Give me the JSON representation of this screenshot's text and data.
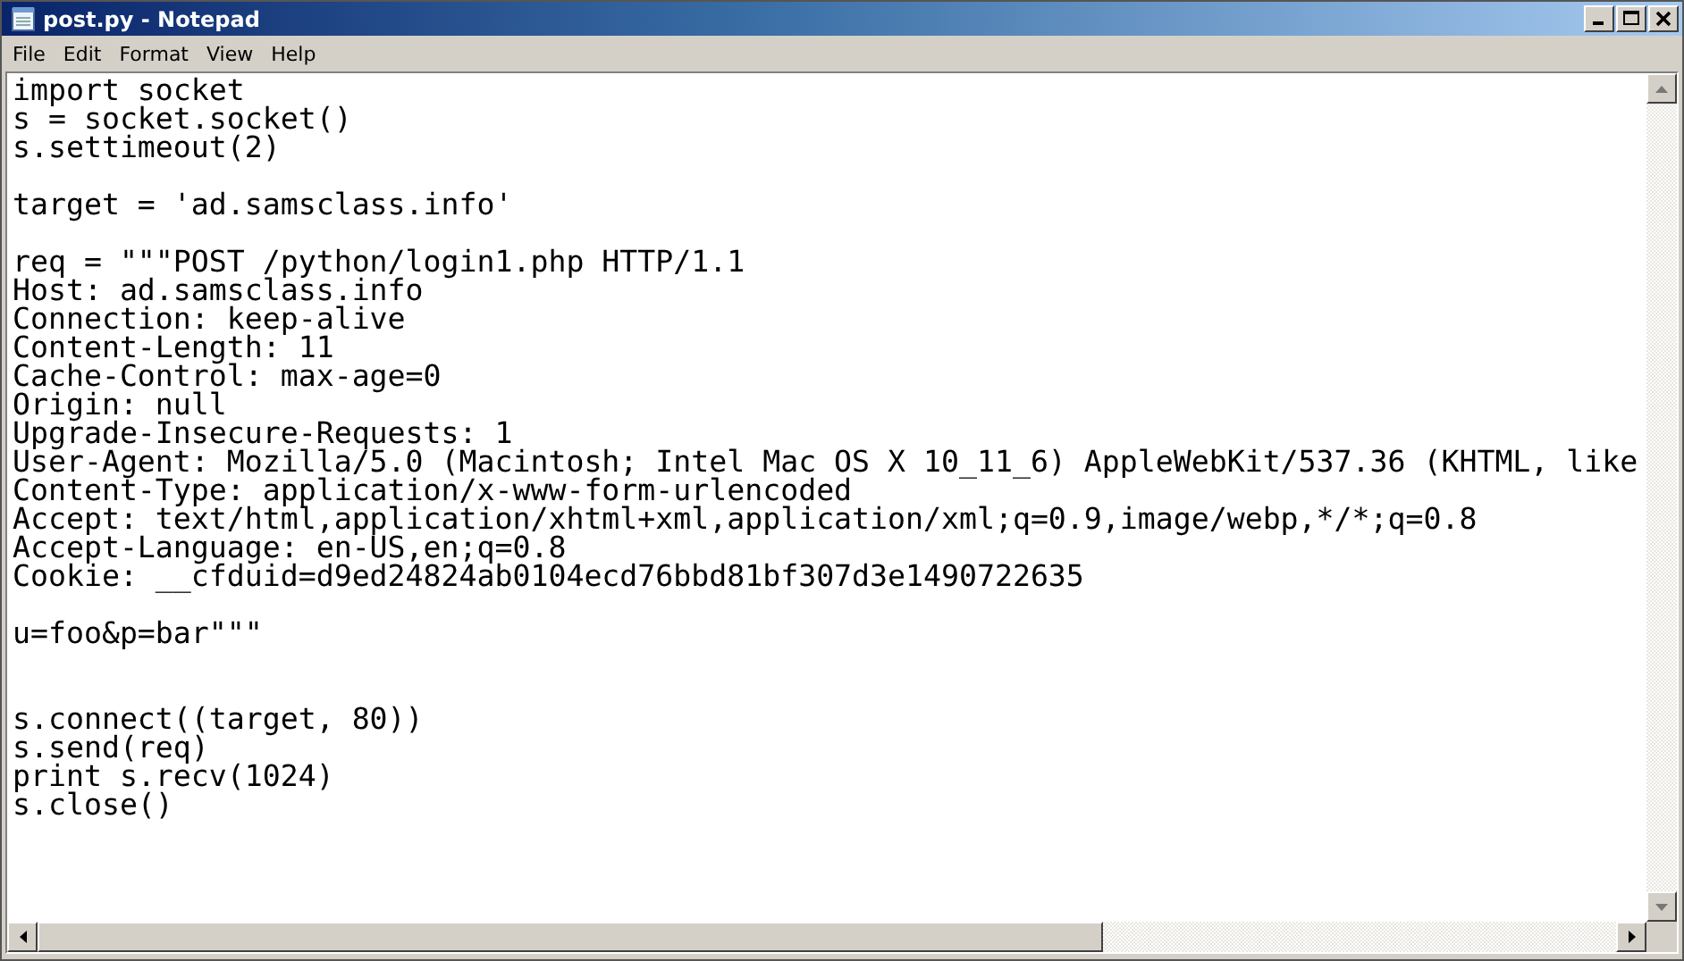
{
  "window": {
    "title": "post.py - Notepad"
  },
  "menu": [
    "File",
    "Edit",
    "Format",
    "View",
    "Help"
  ],
  "editor": {
    "lines": [
      {
        "kind": "code",
        "text": "import socket"
      },
      {
        "kind": "code",
        "text": "s = socket.socket()"
      },
      {
        "kind": "code",
        "text": "s.settimeout(2)"
      },
      {
        "kind": "blank"
      },
      {
        "kind": "code",
        "text": "target = 'ad.samsclass.info'"
      },
      {
        "kind": "blank"
      },
      {
        "kind": "code",
        "text": "req = \"\"\"POST /python/login1.php HTTP/1.1"
      },
      {
        "kind": "code",
        "text": "Host: ad.samsclass.info"
      },
      {
        "kind": "code",
        "text": "Connection: keep-alive"
      },
      {
        "kind": "code",
        "text": "Content-Length: 11"
      },
      {
        "kind": "code",
        "text": "Cache-Control: max-age=0"
      },
      {
        "kind": "code",
        "text": "Origin: null"
      },
      {
        "kind": "code",
        "text": "Upgrade-Insecure-Requests: 1"
      },
      {
        "kind": "code",
        "text": "User-Agent: Mozilla/5.0 (Macintosh; Intel Mac OS X 10_11_6) AppleWebKit/537.36 (KHTML, like"
      },
      {
        "kind": "code",
        "text": "Content-Type: application/x-www-form-urlencoded"
      },
      {
        "kind": "code",
        "text": "Accept: text/html,application/xhtml+xml,application/xml;q=0.9,image/webp,*/*;q=0.8"
      },
      {
        "kind": "code",
        "text": "Accept-Language: en-US,en;q=0.8"
      },
      {
        "kind": "code",
        "text": "Cookie: __cfduid=d9ed24824ab0104ecd76bbd81bf307d3e1490722635"
      },
      {
        "kind": "blank"
      },
      {
        "kind": "code",
        "text": "u=foo&p=bar\"\"\""
      },
      {
        "kind": "blank"
      },
      {
        "kind": "blank"
      },
      {
        "kind": "code",
        "text": "s.connect((target, 80))"
      },
      {
        "kind": "code",
        "text": "s.send(req)"
      },
      {
        "kind": "code",
        "text": "print s.recv(1024)"
      },
      {
        "kind": "code",
        "text": "s.close()"
      }
    ]
  }
}
